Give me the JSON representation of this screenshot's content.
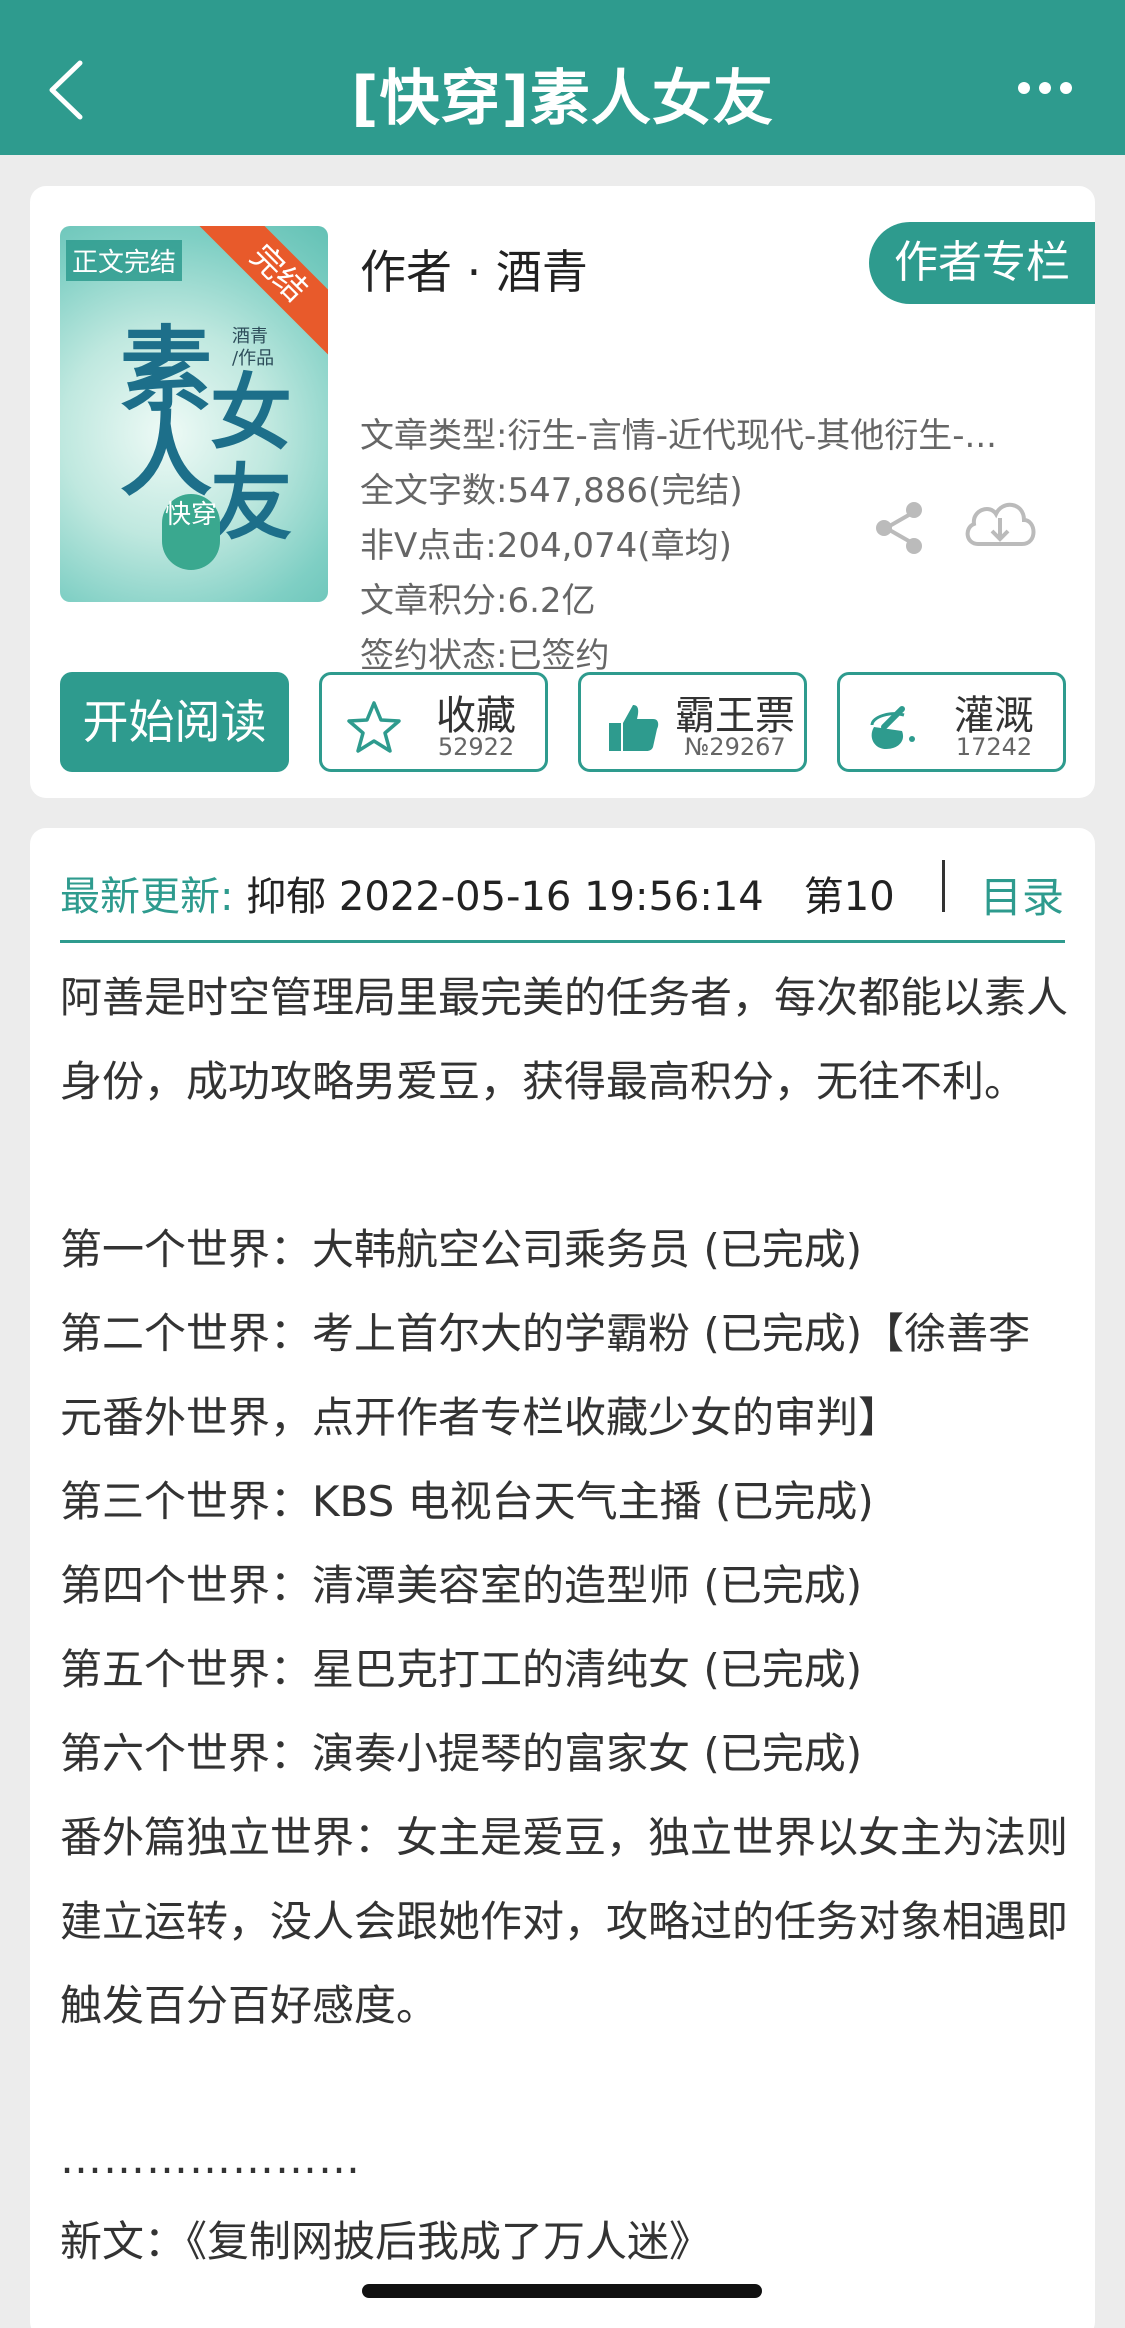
{
  "header": {
    "title": "[快穿]素人女友",
    "back_icon": "back-arrow-icon",
    "more_icon": "more-dots-icon"
  },
  "book": {
    "cover": {
      "tag": "正文完结",
      "ribbon": "完结",
      "title_chars": [
        "素",
        "人",
        "女",
        "友"
      ],
      "seal": "快穿",
      "author_small": "酒青",
      "author_small_sub": "/作品"
    },
    "author_line": "作者 · 酒青",
    "author_column_button": "作者专栏",
    "meta": {
      "type": "文章类型:衍生-言情-近代现代-其他衍生-...",
      "words": "全文字数:547,886(完结)",
      "clicks": "非Ⅴ点击:204,074(章均)",
      "score": "文章积分:6.2亿",
      "contract": "签约状态:已签约"
    }
  },
  "actions": {
    "read": "开始阅读",
    "favorite": {
      "label": "收藏",
      "count": "52922"
    },
    "ticket": {
      "label": "霸王票",
      "count": "№29267"
    },
    "irrigate": {
      "label": "灌溉",
      "count": "17242"
    }
  },
  "update": {
    "label": "最新更新:",
    "value": "抑郁 2022-05-16 19:56:14　第10",
    "toc": "目录"
  },
  "description": [
    "阿善是时空管理局里最完美的任务者，每次都能以素人身份，成功攻略男爱豆，获得最高积分，无往不利。",
    "第一个世界：大韩航空公司乘务员 (已完成)",
    "第二个世界：考上首尔大的学霸粉 (已完成)【徐善李元番外世界，点开作者专栏收藏少女的审判】",
    "第三个世界：KBS 电视台天气主播 (已完成)",
    "第四个世界：清潭美容室的造型师 (已完成)",
    "第五个世界：星巴克打工的清纯女 (已完成)",
    "第六个世界：演奏小提琴的富家女 (已完成)",
    "番外篇独立世界：女主是爱豆，独立世界以女主为法则建立运转，没人会跟她作对，攻略过的任务对象相遇即触发百分百好感度。"
  ],
  "dots": "…………………",
  "truncated": "新文：《复制网披后我成了万人迷》",
  "colors": {
    "accent": "#2e9b8e",
    "ribbon": "#e85a2b"
  }
}
